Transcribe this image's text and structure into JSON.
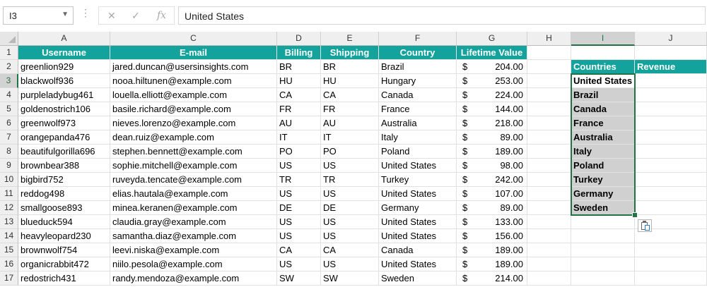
{
  "formula_bar": {
    "name_box": "I3",
    "content": "United States",
    "icons": [
      "dots-icon",
      "cancel-icon",
      "enter-icon",
      "function-icon"
    ]
  },
  "columns": [
    "A",
    "C",
    "D",
    "E",
    "F",
    "G",
    "H",
    "I",
    "J"
  ],
  "row_numbers": [
    "1",
    "2",
    "3",
    "4",
    "5",
    "6",
    "7",
    "8",
    "9",
    "10",
    "11",
    "12",
    "13",
    "14",
    "15",
    "16",
    "17"
  ],
  "headers": {
    "username": "Username",
    "email": "E-mail",
    "billing": "Billing",
    "shipping": "Shipping",
    "country": "Country",
    "lifetime_value": "Lifetime Value",
    "countries": "Countries",
    "revenue": "Revenue"
  },
  "currency_symbol": "$",
  "rows": [
    {
      "username": "greenlion929",
      "email": "jared.duncan@usersinsights.com",
      "billing": "BR",
      "shipping": "BR",
      "country": "Brazil",
      "value": "204.00"
    },
    {
      "username": "blackwolf936",
      "email": "nooa.hiltunen@example.com",
      "billing": "HU",
      "shipping": "HU",
      "country": "Hungary",
      "value": "253.00"
    },
    {
      "username": "purpleladybug461",
      "email": "louella.elliott@example.com",
      "billing": "CA",
      "shipping": "CA",
      "country": "Canada",
      "value": "224.00"
    },
    {
      "username": "goldenostrich106",
      "email": "basile.richard@example.com",
      "billing": "FR",
      "shipping": "FR",
      "country": "France",
      "value": "144.00"
    },
    {
      "username": "greenwolf973",
      "email": "nieves.lorenzo@example.com",
      "billing": "AU",
      "shipping": "AU",
      "country": "Australia",
      "value": "218.00"
    },
    {
      "username": "orangepanda476",
      "email": "dean.ruiz@example.com",
      "billing": "IT",
      "shipping": "IT",
      "country": "Italy",
      "value": "89.00"
    },
    {
      "username": "beautifulgorilla696",
      "email": "stephen.bennett@example.com",
      "billing": "PO",
      "shipping": "PO",
      "country": "Poland",
      "value": "189.00"
    },
    {
      "username": "brownbear388",
      "email": "sophie.mitchell@example.com",
      "billing": "US",
      "shipping": "US",
      "country": "United States",
      "value": "98.00"
    },
    {
      "username": "bigbird752",
      "email": "ruveyda.tencate@example.com",
      "billing": "TR",
      "shipping": "TR",
      "country": "Turkey",
      "value": "242.00"
    },
    {
      "username": "reddog498",
      "email": "elias.hautala@example.com",
      "billing": "US",
      "shipping": "US",
      "country": "United States",
      "value": "107.00"
    },
    {
      "username": "smallgoose893",
      "email": "minea.keranen@example.com",
      "billing": "DE",
      "shipping": "DE",
      "country": "Germany",
      "value": "89.00"
    },
    {
      "username": "blueduck594",
      "email": "claudia.gray@example.com",
      "billing": "US",
      "shipping": "US",
      "country": "United States",
      "value": "133.00"
    },
    {
      "username": "heavyleopard230",
      "email": "samantha.diaz@example.com",
      "billing": "US",
      "shipping": "US",
      "country": "United States",
      "value": "156.00"
    },
    {
      "username": "brownwolf754",
      "email": "leevi.niska@example.com",
      "billing": "CA",
      "shipping": "CA",
      "country": "Canada",
      "value": "189.00"
    },
    {
      "username": "organicrabbit472",
      "email": "niilo.pesola@example.com",
      "billing": "US",
      "shipping": "US",
      "country": "United States",
      "value": "189.00"
    },
    {
      "username": "redostrich431",
      "email": "randy.mendoza@example.com",
      "billing": "SW",
      "shipping": "SW",
      "country": "Sweden",
      "value": "214.00"
    }
  ],
  "countries_list": [
    "United States",
    "Brazil",
    "Canada",
    "France",
    "Australia",
    "Italy",
    "Poland",
    "Turkey",
    "Germany",
    "Sweden"
  ],
  "colors": {
    "header_teal": "#13a39c",
    "selection_green": "#217346",
    "selected_fill": "#d0d0d0"
  }
}
